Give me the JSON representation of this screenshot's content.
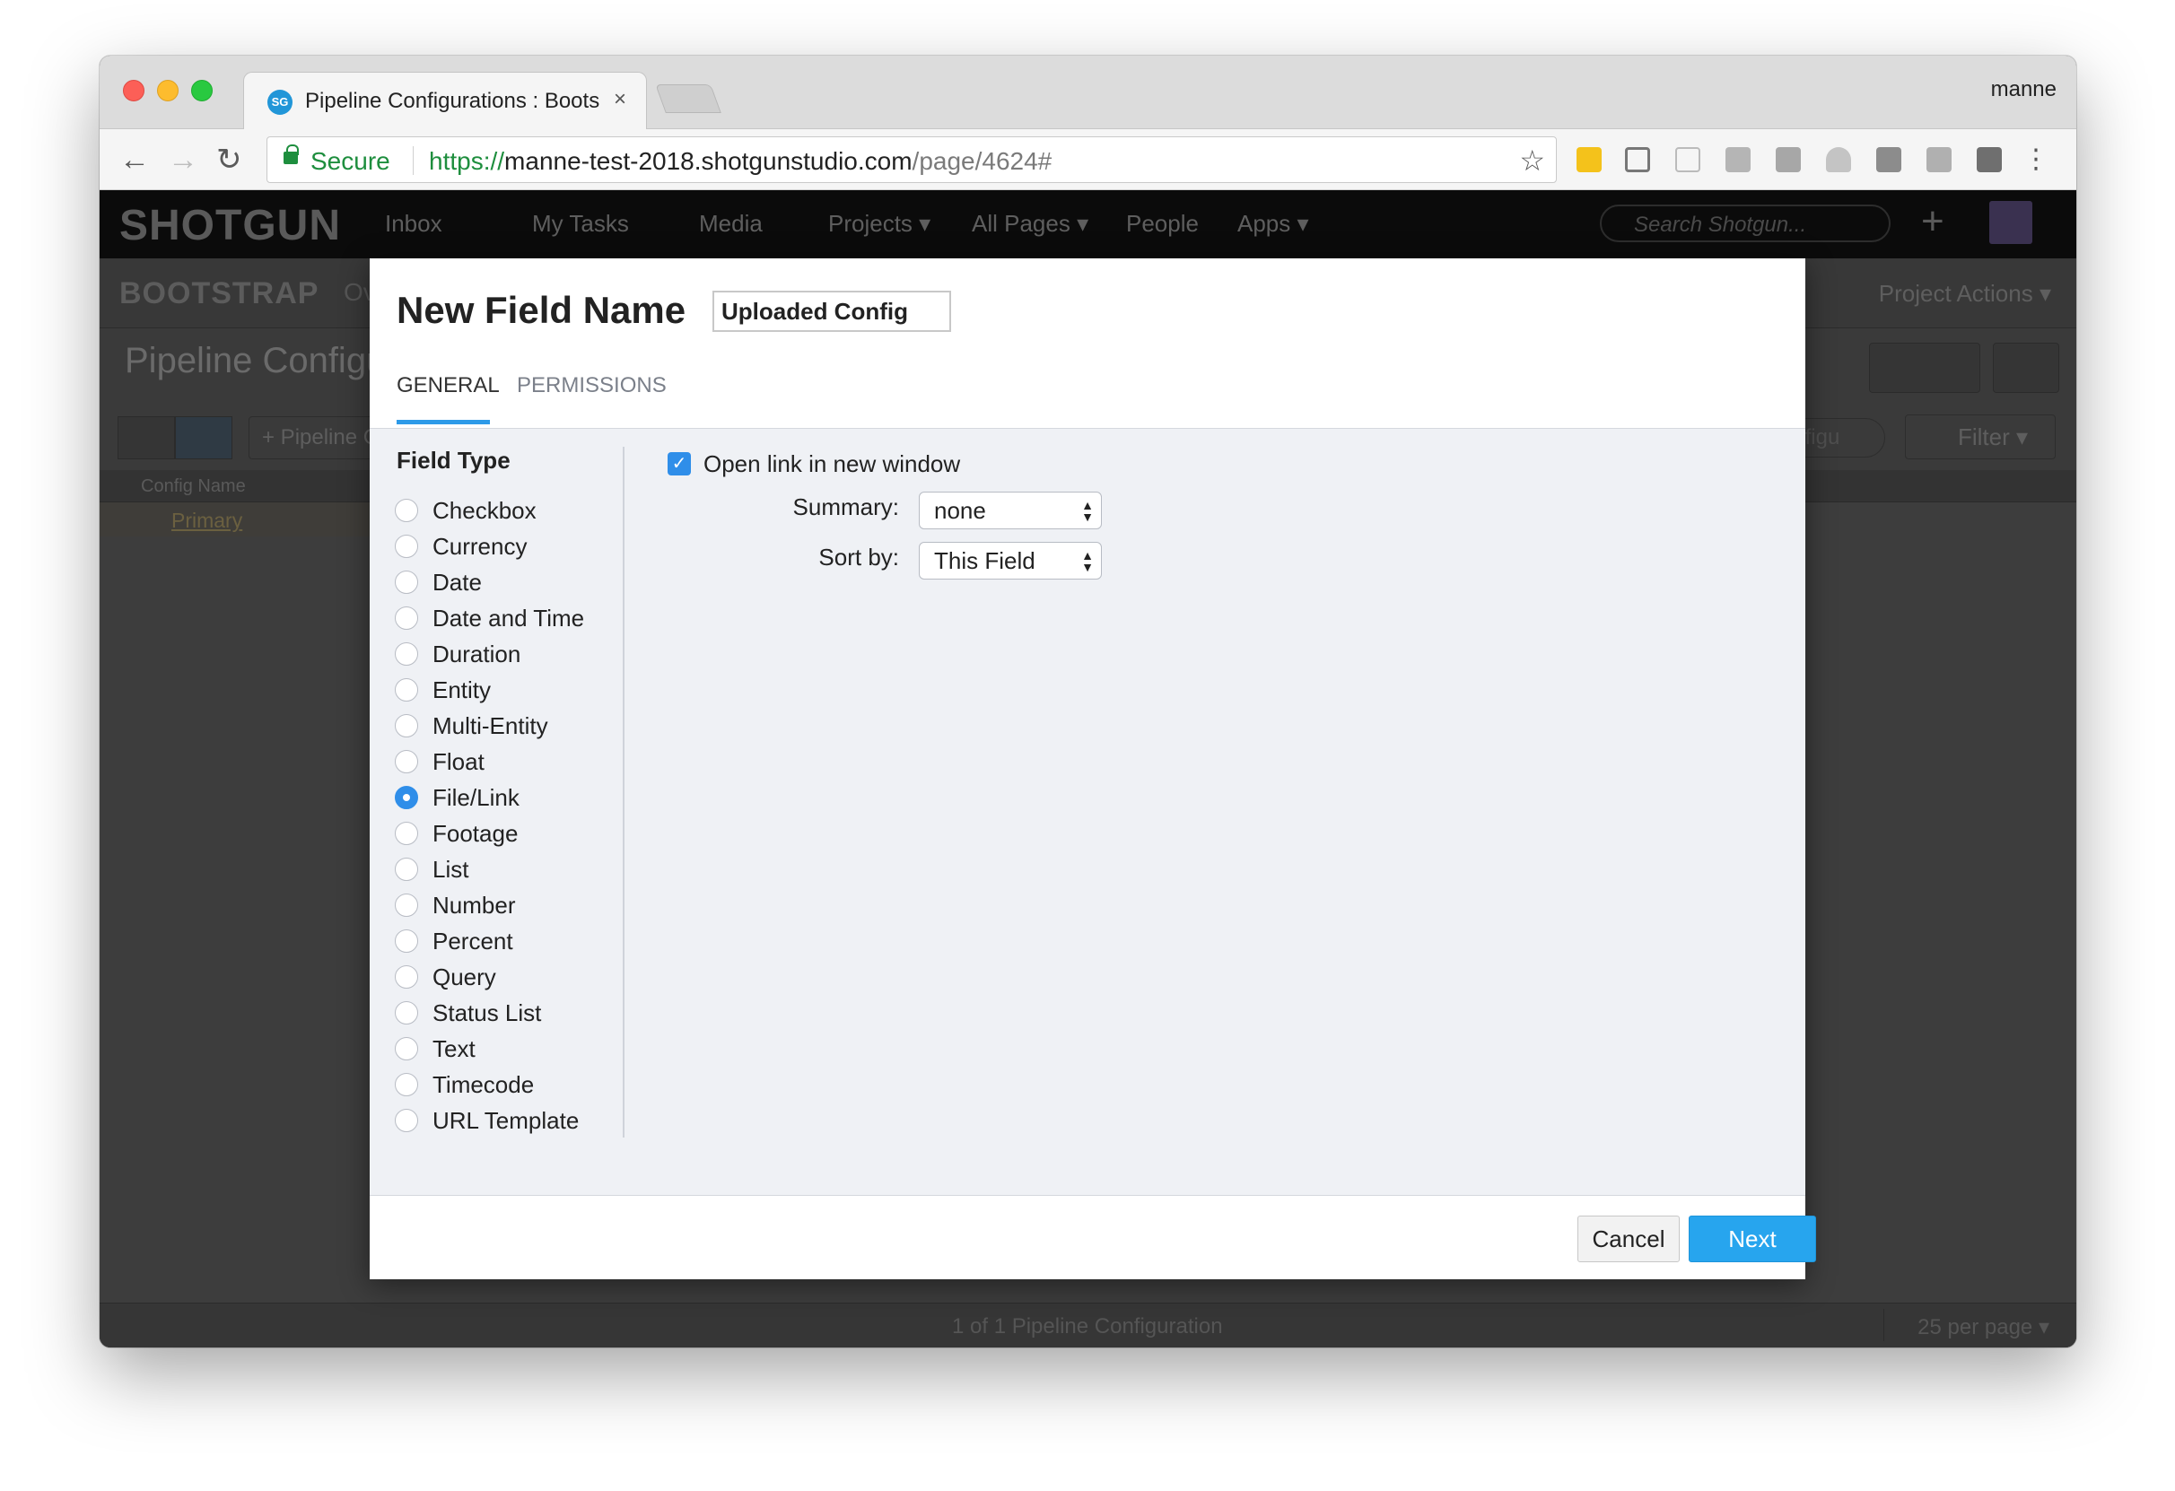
{
  "browser": {
    "tab_title": "Pipeline Configurations : Boots",
    "tab_favicon": "SG",
    "tab_close": "×",
    "profile_name": "manne",
    "secure_label": "Secure",
    "url_scheme": "https://",
    "url_host": "manne-test-2018.shotgunstudio.com",
    "url_path": "/page/4624#",
    "nav_back": "←",
    "nav_forward": "→",
    "nav_reload": "↻",
    "bookmark_star": "☆",
    "menu": "⋮"
  },
  "app": {
    "logo": "SHOTGUN",
    "nav": {
      "inbox": "Inbox",
      "my_tasks": "My Tasks",
      "media": "Media",
      "projects": "Projects ▾",
      "all_pages": "All Pages ▾",
      "people": "People",
      "apps": "Apps ▾"
    },
    "search_placeholder": "Search Shotgun...",
    "plus": "+",
    "project_name": "BOOTSTRAP",
    "project_tab_partial": "Ov",
    "project_actions": "Project Actions ▾",
    "page_title": "Pipeline Configurations",
    "add_button": "+ Pipeline Configuration",
    "search_pill": "figu",
    "filter_button": "Filter ▾",
    "grid_header": "Config Name",
    "grid_row": "Primary",
    "footer_count": "1 of 1 Pipeline Configuration",
    "footer_per_page": "25 per page ▾"
  },
  "dialog": {
    "title": "New Field Name",
    "name_value": "Uploaded Config",
    "tabs": [
      {
        "label": "GENERAL",
        "active": true
      },
      {
        "label": "PERMISSIONS",
        "active": false
      }
    ],
    "field_type_title": "Field Type",
    "field_types": [
      {
        "label": "Checkbox",
        "selected": false
      },
      {
        "label": "Currency",
        "selected": false
      },
      {
        "label": "Date",
        "selected": false
      },
      {
        "label": "Date and Time",
        "selected": false
      },
      {
        "label": "Duration",
        "selected": false
      },
      {
        "label": "Entity",
        "selected": false
      },
      {
        "label": "Multi-Entity",
        "selected": false
      },
      {
        "label": "Float",
        "selected": false
      },
      {
        "label": "File/Link",
        "selected": true
      },
      {
        "label": "Footage",
        "selected": false
      },
      {
        "label": "List",
        "selected": false
      },
      {
        "label": "Number",
        "selected": false
      },
      {
        "label": "Percent",
        "selected": false
      },
      {
        "label": "Query",
        "selected": false
      },
      {
        "label": "Status List",
        "selected": false
      },
      {
        "label": "Text",
        "selected": false
      },
      {
        "label": "Timecode",
        "selected": false
      },
      {
        "label": "URL Template",
        "selected": false
      }
    ],
    "open_new_window_label": "Open link in new window",
    "open_new_window_checked": true,
    "summary_label": "Summary:",
    "summary_value": "none",
    "sort_label": "Sort by:",
    "sort_value": "This Field",
    "cancel_label": "Cancel",
    "next_label": "Next"
  },
  "colors": {
    "accent": "#27a5ee",
    "radio_selected": "#2f8ee9",
    "secure_green": "#1e8e3e"
  }
}
